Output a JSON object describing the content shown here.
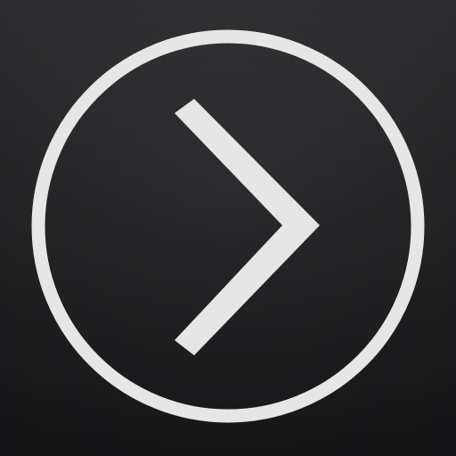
{
  "icon": {
    "name": "forward-chevron-app-icon",
    "glyph": "chevron-right-icon",
    "ring": "circle-outline",
    "colors": {
      "background_top": "#37373a",
      "background_bottom": "#1b1b1d",
      "stroke": "#e6e6e6"
    }
  }
}
